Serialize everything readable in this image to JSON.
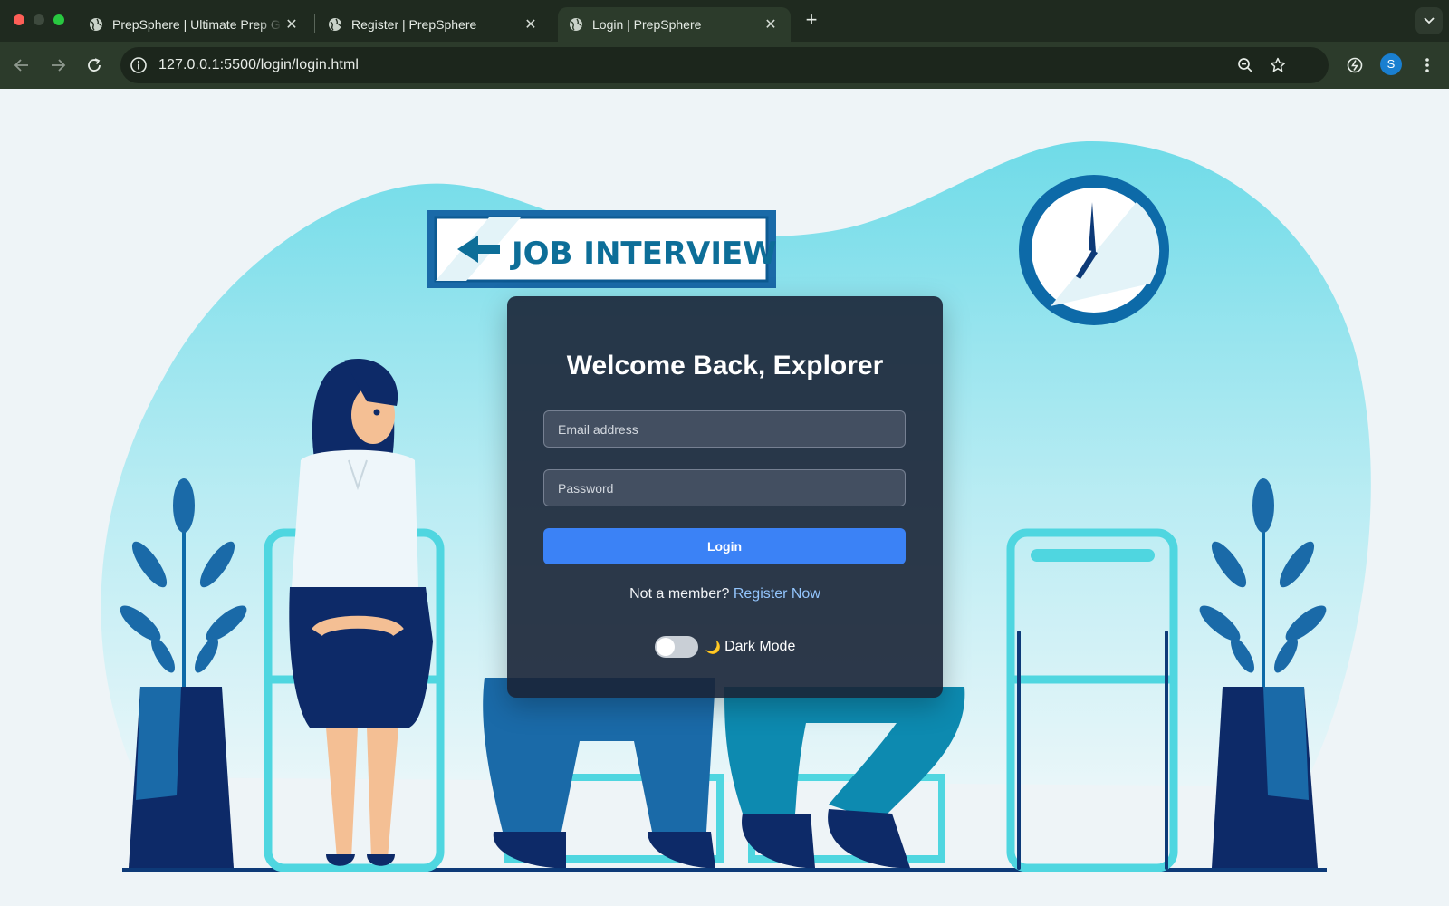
{
  "browser": {
    "tabs": [
      {
        "title": "PrepSphere | Ultimate Prep G",
        "active": false
      },
      {
        "title": "Register | PrepSphere",
        "active": false
      },
      {
        "title": "Login | PrepSphere",
        "active": true
      }
    ],
    "url": "127.0.0.1:5500/login/login.html",
    "profile_initial": "S"
  },
  "illustration": {
    "sign_text": "JOB INTERVIEW"
  },
  "login": {
    "title": "Welcome Back, Explorer",
    "email_placeholder": "Email address",
    "password_placeholder": "Password",
    "button_label": "Login",
    "register_prompt": "Not a member?",
    "register_link": "Register Now",
    "dark_mode_label": "Dark Mode",
    "dark_mode_on": false
  },
  "colors": {
    "accent": "#3b82f6",
    "link": "#93c5fd",
    "card_bg": "#1a2436"
  }
}
